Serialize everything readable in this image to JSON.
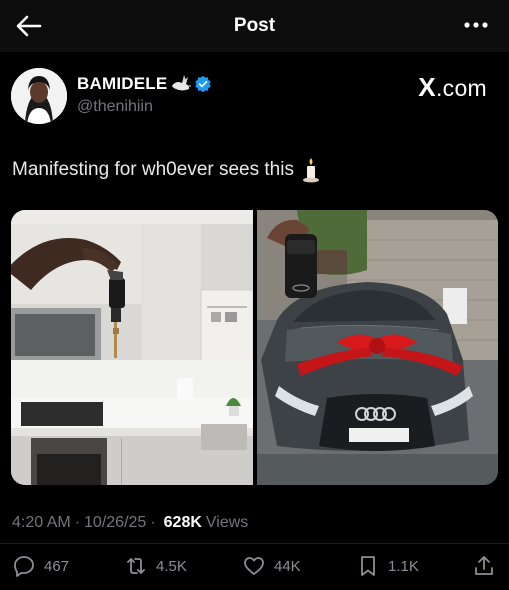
{
  "header": {
    "title": "Post",
    "back_icon": "arrow-left-icon",
    "more_icon": "more-dots-icon"
  },
  "author": {
    "display_name": "BAMIDELE",
    "handle": "@thenihiin",
    "emoji": "dove-icon",
    "verified_color": "#1d9bf0"
  },
  "watermark": {
    "x": "X",
    "suffix": ".com"
  },
  "post": {
    "text": "Manifesting for wh0ever sees this",
    "emoji": "candle-icon"
  },
  "media": [
    {
      "name": "kitchen-photo",
      "description": "kitchen-keys"
    },
    {
      "name": "car-photo",
      "description": "audi-with-red-bow"
    }
  ],
  "meta": {
    "time": "4:20 AM",
    "date": "10/26/25",
    "views_count": "628K",
    "views_label": "Views"
  },
  "actions": {
    "replies": "467",
    "reposts": "4.5K",
    "likes": "44K",
    "bookmarks": "1.1K"
  }
}
